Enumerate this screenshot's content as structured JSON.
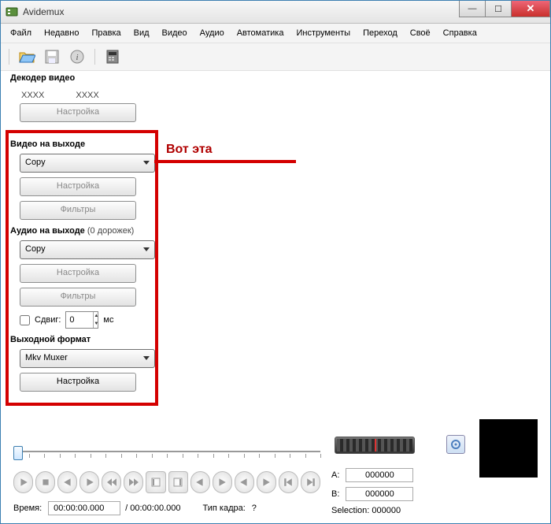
{
  "window": {
    "title": "Avidemux"
  },
  "menu": [
    "Файл",
    "Недавно",
    "Правка",
    "Вид",
    "Видео",
    "Аудио",
    "Автоматика",
    "Инструменты",
    "Переход",
    "Своё",
    "Справка"
  ],
  "decoder": {
    "title": "Декодер видео",
    "x1": "XXXX",
    "x2": "XXXX",
    "configure": "Настройка"
  },
  "video_out": {
    "title": "Видео на выходе",
    "codec": "Copy",
    "configure": "Настройка",
    "filters": "Фильтры"
  },
  "audio_out": {
    "title": "Аудио на выходе",
    "tracks_suffix": "(0 дорожек)",
    "codec": "Copy",
    "configure": "Настройка",
    "filters": "Фильтры",
    "shift_label": "Сдвиг:",
    "shift_value": "0",
    "shift_unit": "мс"
  },
  "output_format": {
    "title": "Выходной формат",
    "muxer": "Mkv Muxer",
    "configure": "Настройка"
  },
  "annotation": {
    "text": "Вот эта"
  },
  "bottom": {
    "time_label": "Время:",
    "time_value": "00:00:00.000",
    "duration": "/ 00:00:00.000",
    "frametype_label": "Тип кадра:",
    "frametype_value": "?",
    "a_label": "A:",
    "a_value": "000000",
    "b_label": "B:",
    "b_value": "000000",
    "selection_label": "Selection:",
    "selection_value": "000000"
  }
}
